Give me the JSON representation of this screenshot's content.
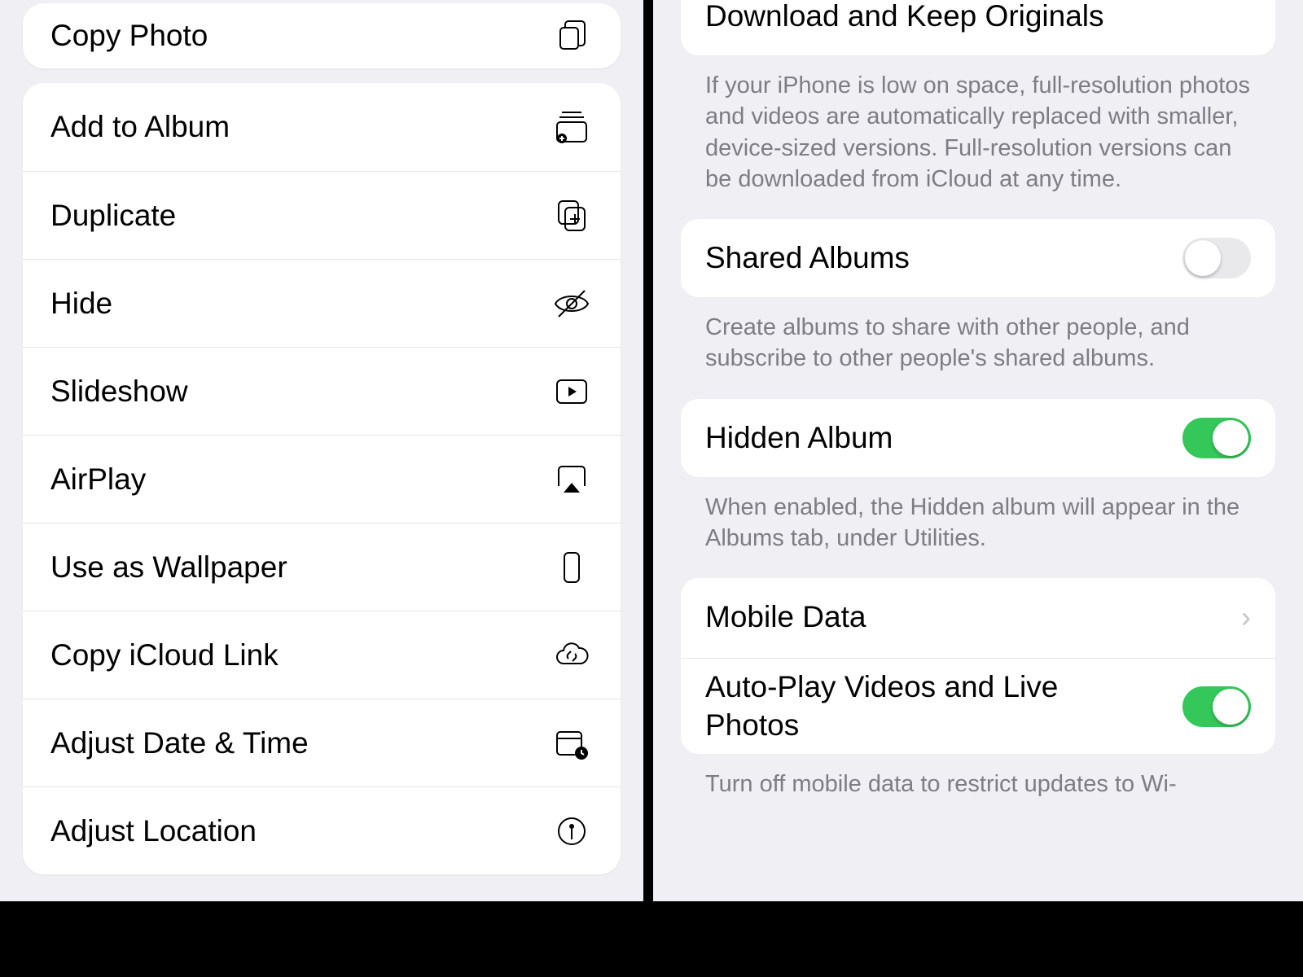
{
  "left": {
    "copy_photo": "Copy Photo",
    "add_to_album": "Add to Album",
    "duplicate": "Duplicate",
    "hide": "Hide",
    "slideshow": "Slideshow",
    "airplay": "AirPlay",
    "use_as_wallpaper": "Use as Wallpaper",
    "copy_icloud_link": "Copy iCloud Link",
    "adjust_date_time": "Adjust Date & Time",
    "adjust_location": "Adjust Location"
  },
  "right": {
    "download_originals": "Download and Keep Originals",
    "download_footer": "If your iPhone is low on space, full-resolution photos and videos are automatically replaced with smaller, device-sized versions. Full-resolution versions can be downloaded from iCloud at any time.",
    "shared_albums": "Shared Albums",
    "shared_albums_on": false,
    "shared_albums_footer": "Create albums to share with other people, and subscribe to other people's shared albums.",
    "hidden_album": "Hidden Album",
    "hidden_album_on": true,
    "hidden_album_footer": "When enabled, the Hidden album will appear in the Albums tab, under Utilities.",
    "mobile_data": "Mobile Data",
    "autoplay": "Auto-Play Videos and Live Photos",
    "autoplay_on": true,
    "autoplay_footer": "Turn off mobile data to restrict updates to Wi-"
  }
}
